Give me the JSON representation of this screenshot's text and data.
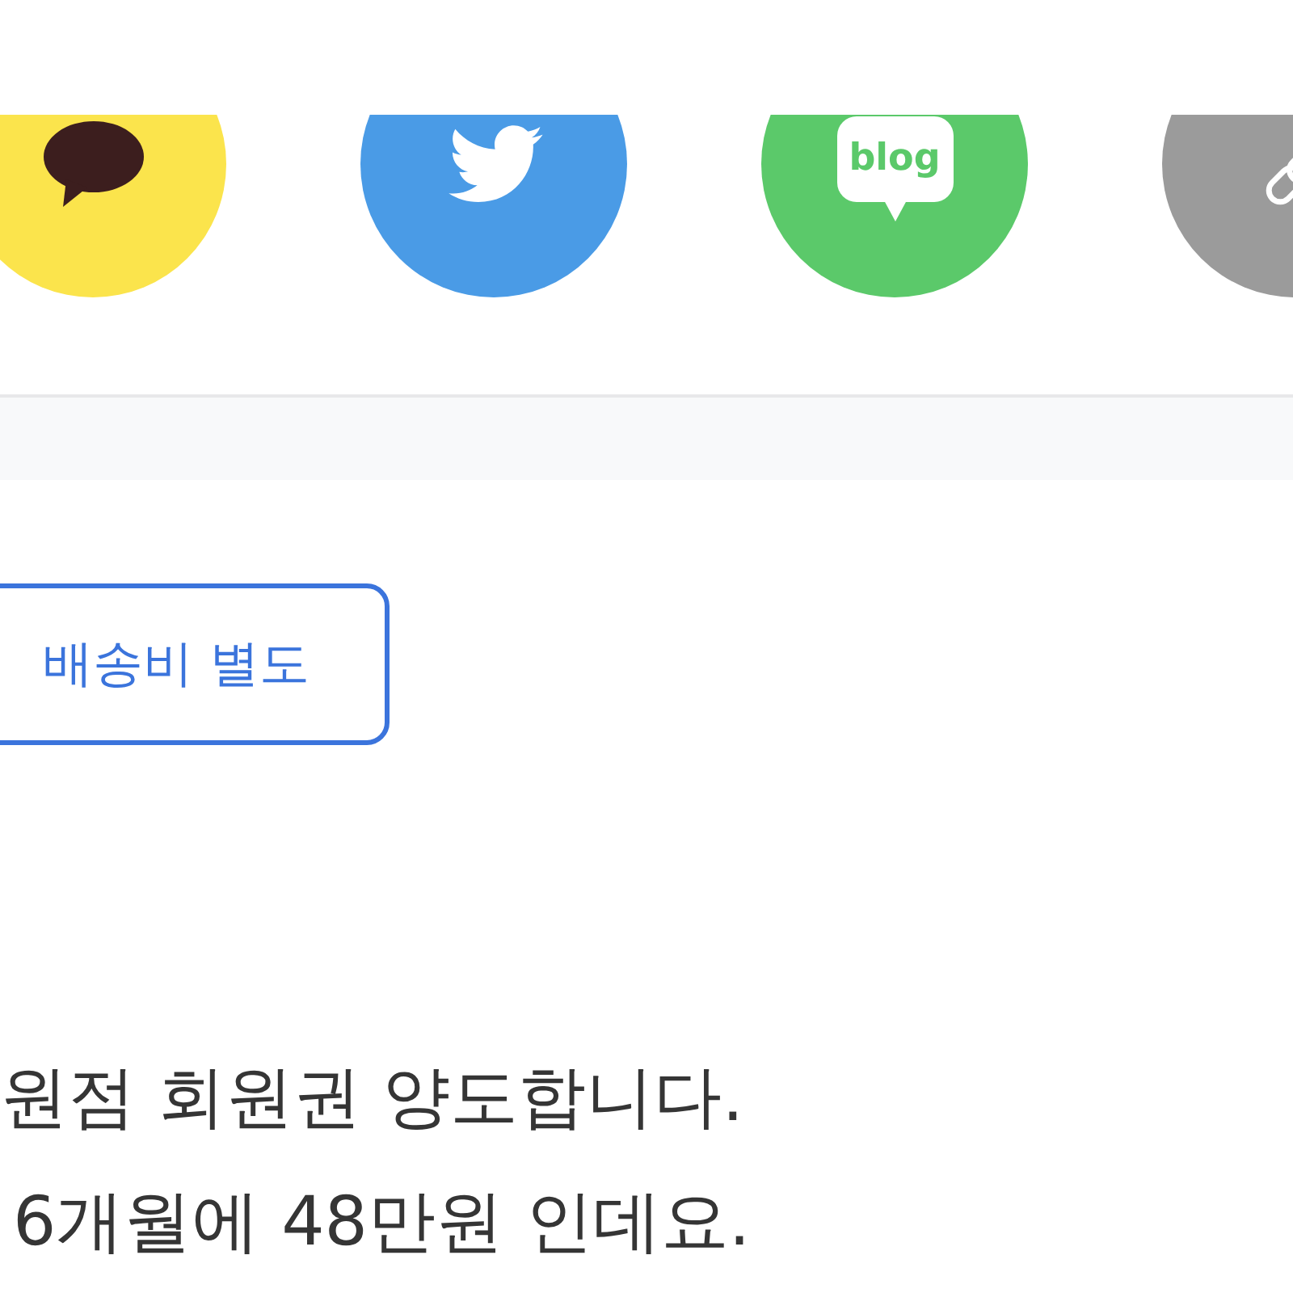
{
  "share_buttons": [
    {
      "kind": "kakao"
    },
    {
      "kind": "twitter"
    },
    {
      "kind": "blog",
      "label": "blog"
    },
    {
      "kind": "link"
    }
  ],
  "shipping_tag": {
    "label": "배송비 별도"
  },
  "description": {
    "lines": [
      "원점 회원권 양도합니다.",
      "6개월에 48만원 인데요."
    ]
  }
}
